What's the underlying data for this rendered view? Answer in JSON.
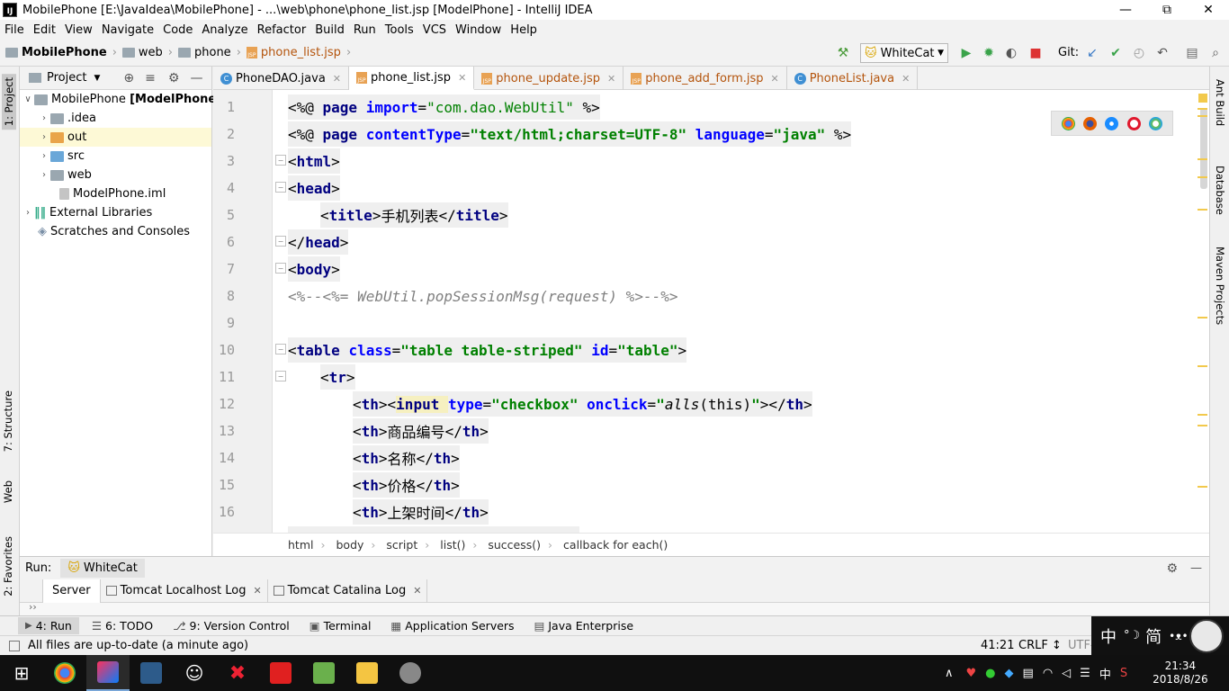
{
  "window": {
    "title": "MobilePhone [E:\\JavaIdea\\MobilePhone] - ...\\web\\phone\\phone_list.jsp [ModelPhone] - IntelliJ IDEA",
    "minimize": "—",
    "restore": "⧉",
    "close": "✕"
  },
  "menu": [
    "File",
    "Edit",
    "View",
    "Navigate",
    "Code",
    "Analyze",
    "Refactor",
    "Build",
    "Run",
    "Tools",
    "VCS",
    "Window",
    "Help"
  ],
  "breadcrumb": [
    "MobilePhone",
    "web",
    "phone",
    "phone_list.jsp"
  ],
  "toolbar": {
    "run_config": "WhiteCat",
    "git_label": "Git:"
  },
  "project_panel": {
    "title": "Project",
    "tree": [
      {
        "label": "MobilePhone",
        "suffix": "[ModelPhone]"
      },
      {
        "label": ".idea"
      },
      {
        "label": "out"
      },
      {
        "label": "src"
      },
      {
        "label": "web"
      },
      {
        "label": "ModelPhone.iml"
      },
      {
        "label": "External Libraries"
      },
      {
        "label": "Scratches and Consoles"
      }
    ]
  },
  "editor_tabs": [
    {
      "label": "PhoneDAO.java"
    },
    {
      "label": "phone_list.jsp"
    },
    {
      "label": "phone_update.jsp"
    },
    {
      "label": "phone_add_form.jsp"
    },
    {
      "label": "PhoneList.java"
    }
  ],
  "code_lines": [
    {
      "n": "1"
    },
    {
      "n": "2"
    },
    {
      "n": "3"
    },
    {
      "n": "4"
    },
    {
      "n": "5"
    },
    {
      "n": "6"
    },
    {
      "n": "7"
    },
    {
      "n": "8"
    },
    {
      "n": "9"
    },
    {
      "n": "10"
    },
    {
      "n": "11"
    },
    {
      "n": "12"
    },
    {
      "n": "13"
    },
    {
      "n": "14"
    },
    {
      "n": "15"
    },
    {
      "n": "16"
    }
  ],
  "code": {
    "l1": [
      "<%@ ",
      "page ",
      "import",
      "=",
      "\"com.dao.WebUtil\"",
      " %>"
    ],
    "l2": [
      "<%@ ",
      "page ",
      "contentType",
      "=",
      "\"text/html;charset=UTF-8\"",
      " ",
      "language",
      "=",
      "\"java\"",
      " %>"
    ],
    "l3": [
      "<",
      "html",
      ">"
    ],
    "l4": [
      "<",
      "head",
      ">"
    ],
    "l5": [
      "<",
      "title",
      ">",
      "手机列表",
      "</",
      "title",
      ">"
    ],
    "l6": [
      "</",
      "head",
      ">"
    ],
    "l7": [
      "<",
      "body",
      ">"
    ],
    "l8": "<%--<%= WebUtil.popSessionMsg(request) %>--%>",
    "l10": [
      "<",
      "table ",
      "class",
      "=",
      "\"table table-striped\"",
      " ",
      "id",
      "=",
      "\"table\"",
      ">"
    ],
    "l11": [
      "<",
      "tr",
      ">"
    ],
    "l12": [
      "<",
      "th",
      "><",
      "input ",
      "type",
      "=",
      "\"checkbox\"",
      " ",
      "onclick",
      "=",
      "\"",
      "alls",
      "(this)",
      "\"",
      "></",
      "th",
      ">"
    ],
    "l13": [
      "<",
      "th",
      ">",
      "商品编号",
      "</",
      "th",
      ">"
    ],
    "l14": [
      "<",
      "th",
      ">",
      "名称",
      "</",
      "th",
      ">"
    ],
    "l15": [
      "<",
      "th",
      ">",
      "价格",
      "</",
      "th",
      ">"
    ],
    "l16": [
      "<",
      "th",
      ">",
      "上架时间",
      "</",
      "th",
      ">"
    ]
  },
  "editor_breadcrumb": [
    "html",
    "body",
    "script",
    "list()",
    "success()",
    "callback for each()"
  ],
  "left_tool_tabs": [
    "1: Project",
    "7: Structure",
    "Web",
    "2: Favorites"
  ],
  "right_tool_tabs": [
    "Ant Build",
    "Database",
    "Maven Projects"
  ],
  "run_panel": {
    "label": "Run:",
    "config": "WhiteCat",
    "tabs": [
      "Server",
      "Tomcat Localhost Log",
      "Tomcat Catalina Log"
    ]
  },
  "bottom_tabs": [
    "4: Run",
    "6: TODO",
    "9: Version Control",
    "Terminal",
    "Application Servers",
    "Java Enterprise"
  ],
  "status": {
    "message": "All files are up-to-date (a minute ago)",
    "position": "41:21",
    "line_sep": "CRLF ↕",
    "encoding": "UTF-"
  },
  "ime": {
    "chars": [
      "中",
      "°☽",
      "简",
      "•ᴥ•"
    ]
  },
  "taskbar": {
    "time": "21:34",
    "date": "2018/8/26",
    "ime_lang": "中"
  },
  "colors": {
    "tag": "#000080",
    "attr": "#0000ff",
    "string": "#008000",
    "comment": "#808080"
  }
}
